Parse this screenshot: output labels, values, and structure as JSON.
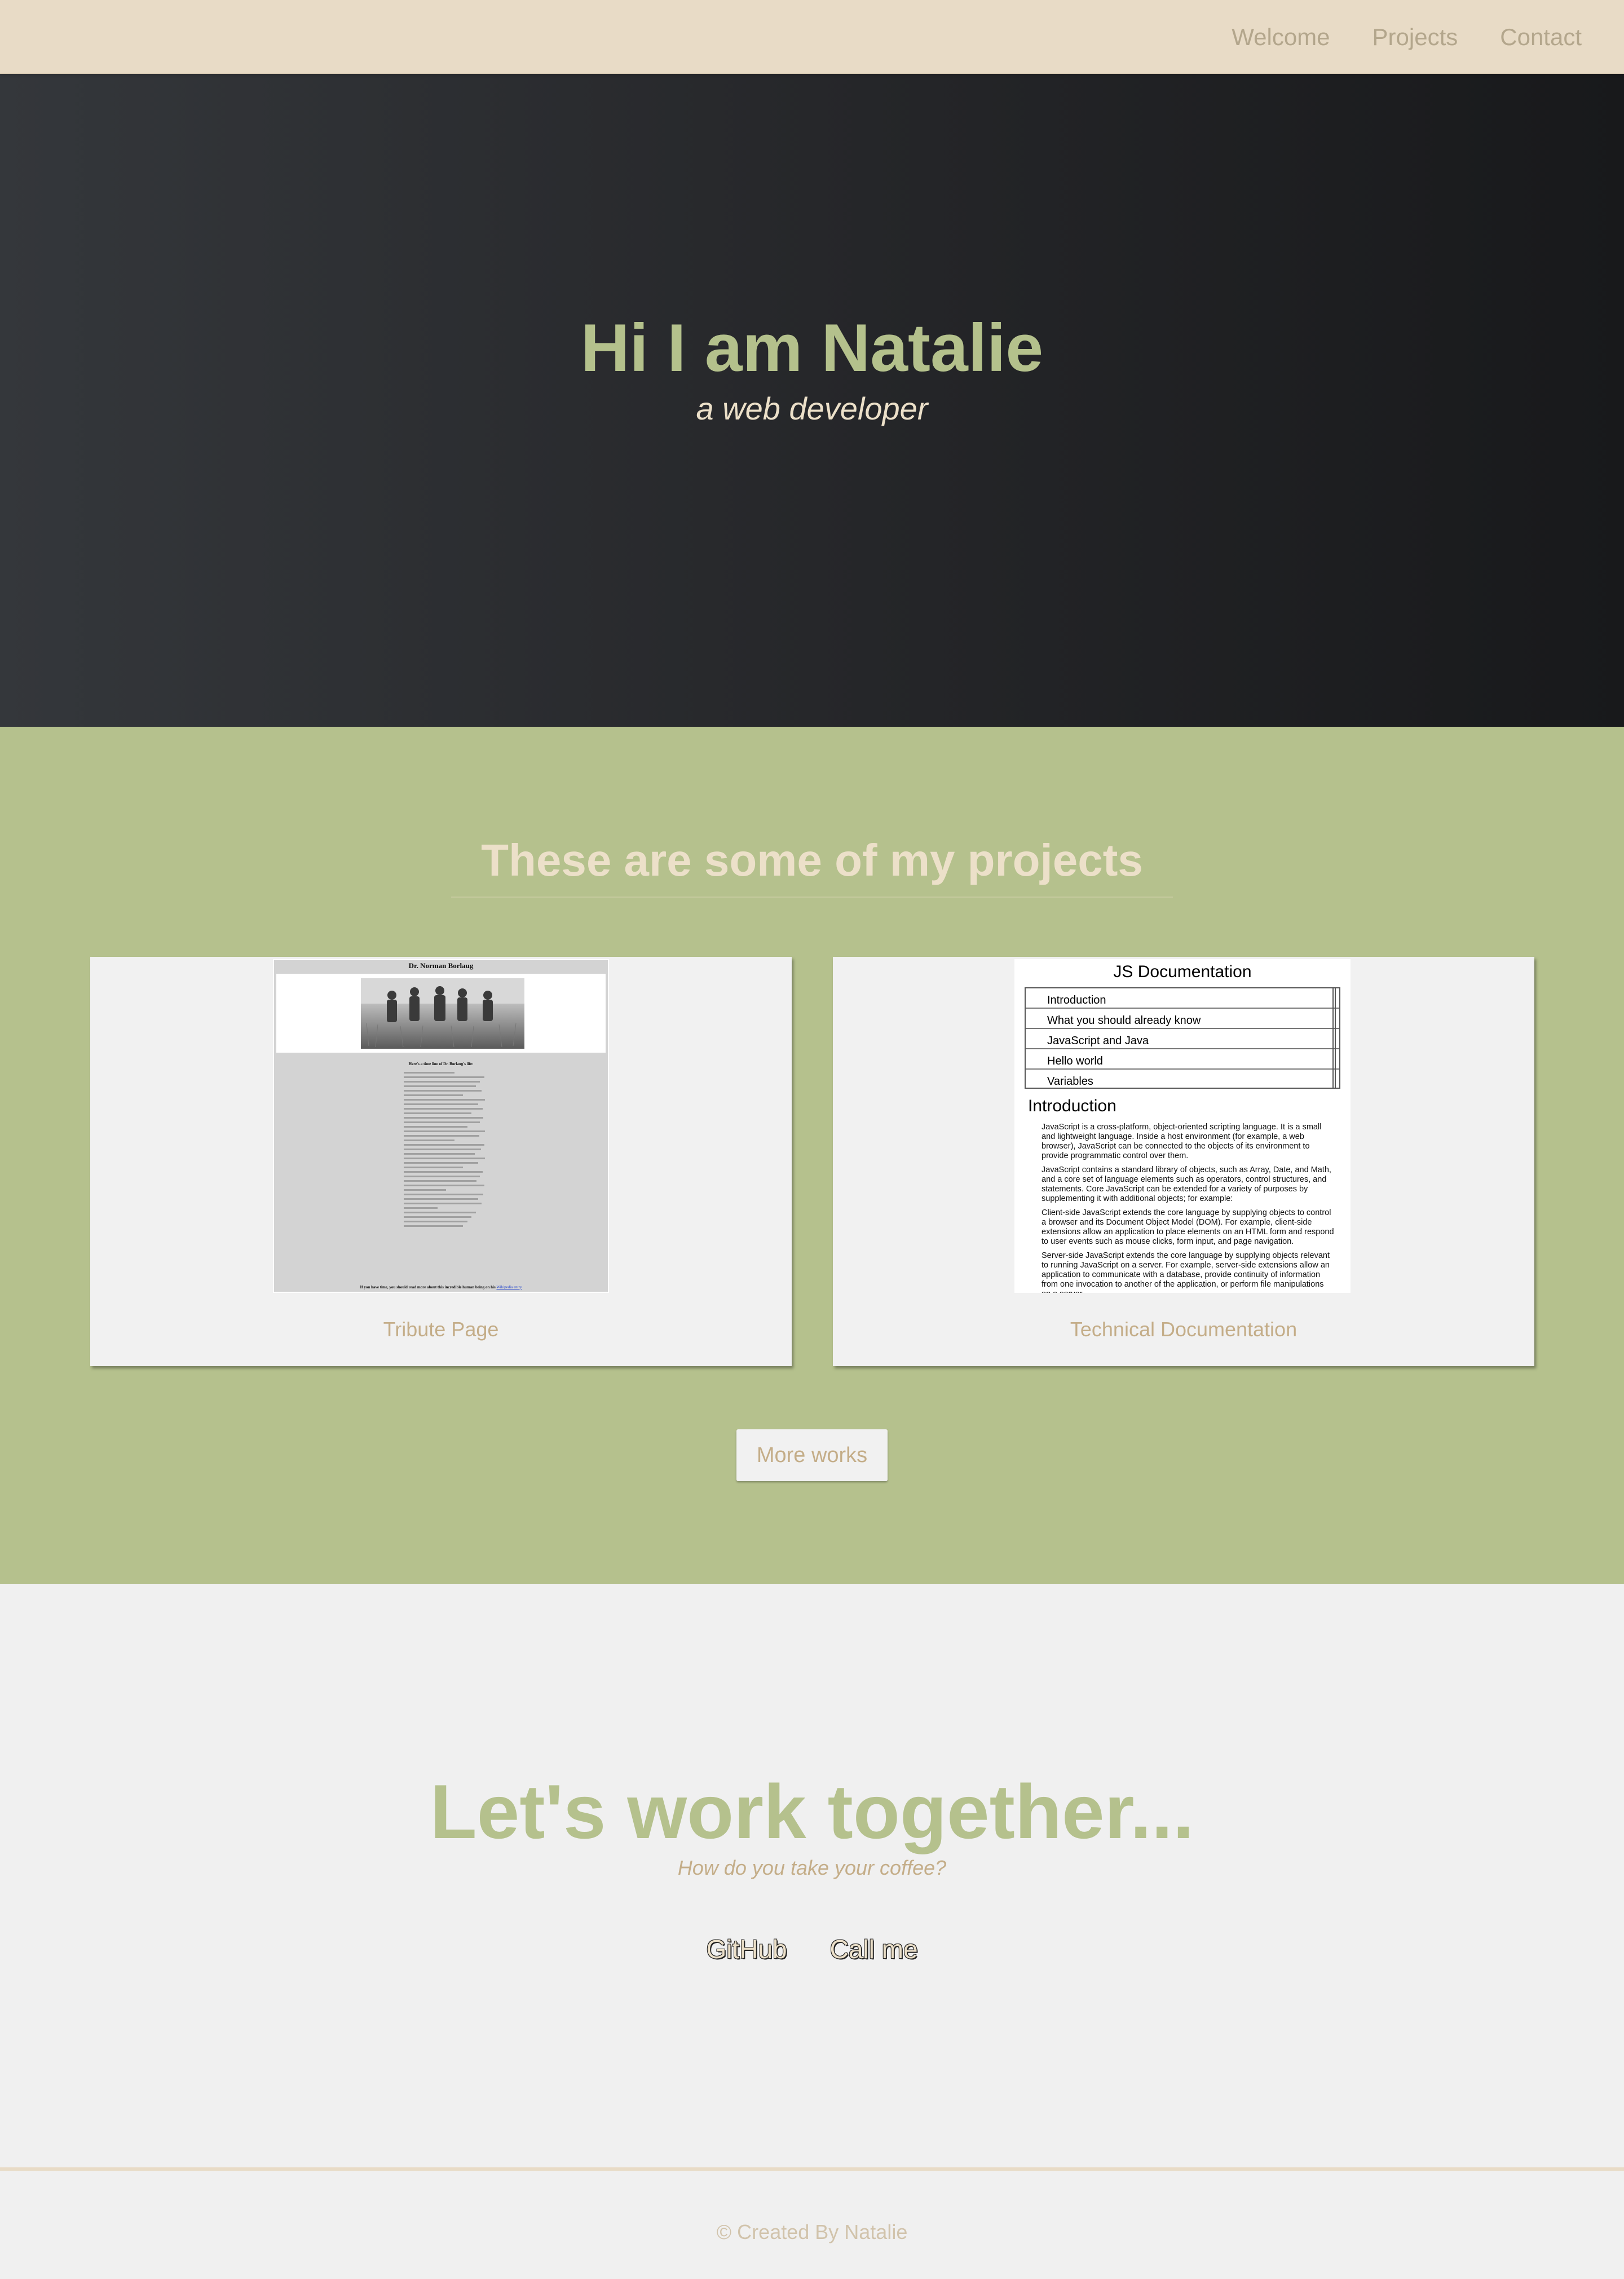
{
  "nav": {
    "links": [
      "Welcome",
      "Projects",
      "Contact"
    ]
  },
  "hero": {
    "title": "Hi I am Natalie",
    "subtitle": "a web developer"
  },
  "projects": {
    "title": "These are some of my projects",
    "cards": [
      {
        "label": "Tribute Page",
        "thumbnail": {
          "title": "Dr. Norman Borlaug",
          "heading": "Here's a time line of Dr. Borlaug's life:",
          "footer_text": "If you have time, you should read more about this incredible human being on his",
          "footer_link": "Wikipedia entry"
        }
      },
      {
        "label": "Technical Documentation",
        "thumbnail": {
          "title": "JS Documentation",
          "nav_items": [
            "Introduction",
            "What you should already know",
            "JavaScript and Java",
            "Hello world",
            "Variables"
          ],
          "section_heading": "Introduction",
          "paragraphs": [
            "JavaScript is a cross-platform, object-oriented scripting language. It is a small and lightweight language. Inside a host environment (for example, a web browser), JavaScript can be connected to the objects of its environment to provide programmatic control over them.",
            "JavaScript contains a standard library of objects, such as Array, Date, and Math, and a core set of language elements such as operators, control structures, and statements. Core JavaScript can be extended for a variety of purposes by supplementing it with additional objects; for example:",
            "Client-side JavaScript extends the core language by supplying objects to control a browser and its Document Object Model (DOM). For example, client-side extensions allow an application to place elements on an HTML form and respond to user events such as mouse clicks, form input, and page navigation.",
            "Server-side JavaScript extends the core language by supplying objects relevant to running JavaScript on a server. For example, server-side extensions allow an application to communicate with a database, provide continuity of information from one invocation to another of the application, or perform file manipulations on a server."
          ]
        }
      }
    ],
    "more_button": "More works"
  },
  "contact": {
    "title": "Let's work together...",
    "subtitle": "How do you take your coffee?",
    "links": [
      "GitHub",
      "Call me"
    ]
  },
  "footer": {
    "text": "© Created By Natalie"
  },
  "colors": {
    "nav_bg": "#e8dbc6",
    "accent_green": "#b5c18d",
    "cream": "#ece0c9",
    "tan_text": "#c4ad88"
  }
}
